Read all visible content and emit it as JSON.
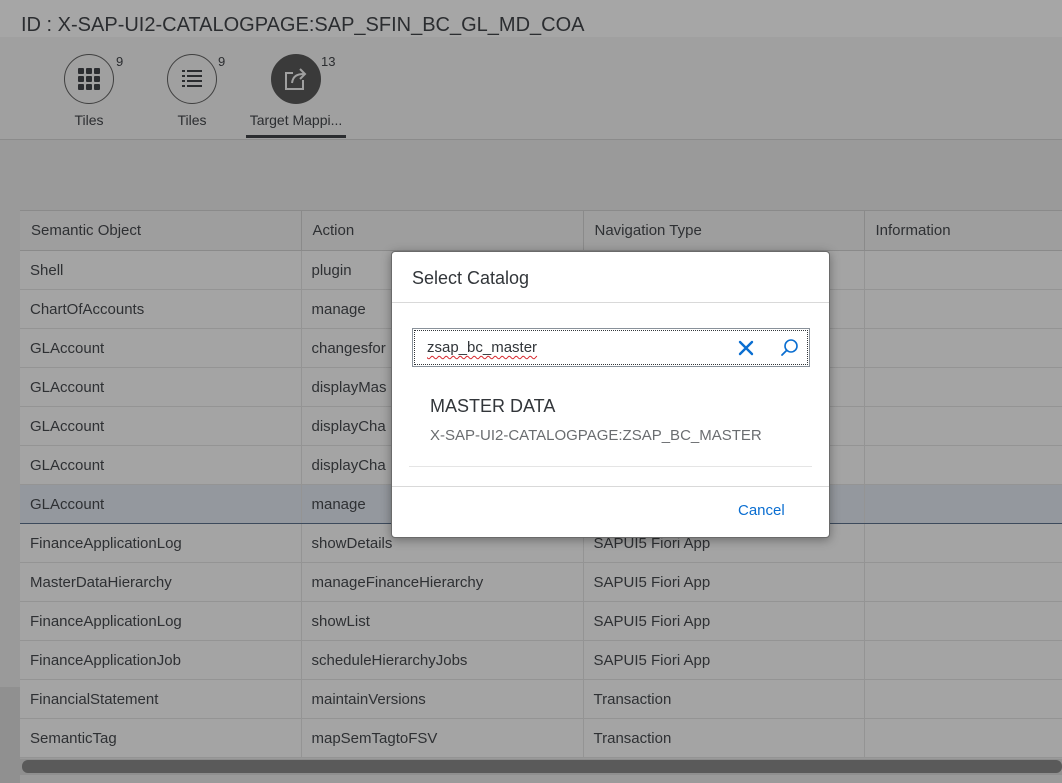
{
  "page": {
    "title": "ID : X-SAP-UI2-CATALOGPAGE:SAP_SFIN_BC_GL_MD_COA"
  },
  "icon_tabs": [
    {
      "label": "Tiles",
      "count": "9",
      "icon": "grid-icon"
    },
    {
      "label": "Tiles",
      "count": "9",
      "icon": "list-icon"
    },
    {
      "label": "Target Mappi...",
      "count": "13",
      "icon": "share-icon",
      "selected": true
    }
  ],
  "table": {
    "columns": [
      "Semantic Object",
      "Action",
      "Navigation Type",
      "Information"
    ],
    "rows": [
      [
        "Shell",
        "plugin",
        "",
        ""
      ],
      [
        "ChartOfAccounts",
        "manage",
        "",
        ""
      ],
      [
        "GLAccount",
        "changesfor",
        "",
        ""
      ],
      [
        "GLAccount",
        "displayMas",
        "",
        ""
      ],
      [
        "GLAccount",
        "displayCha",
        "",
        ""
      ],
      [
        "GLAccount",
        "displayCha",
        "",
        ""
      ],
      [
        "GLAccount",
        "manage",
        "",
        ""
      ],
      [
        "FinanceApplicationLog",
        "showDetails",
        "SAPUI5 Fiori App",
        ""
      ],
      [
        "MasterDataHierarchy",
        "manageFinanceHierarchy",
        "SAPUI5 Fiori App",
        ""
      ],
      [
        "FinanceApplicationLog",
        "showList",
        "SAPUI5 Fiori App",
        ""
      ],
      [
        "FinanceApplicationJob",
        "scheduleHierarchyJobs",
        "SAPUI5 Fiori App",
        ""
      ],
      [
        "FinancialStatement",
        "maintainVersions",
        "Transaction",
        ""
      ],
      [
        "SemanticTag",
        "mapSemTagtoFSV",
        "Transaction",
        ""
      ]
    ]
  },
  "dialog": {
    "title": "Select Catalog",
    "search_value": "zsap_bc_master",
    "results": [
      {
        "title": "MASTER DATA",
        "description": "X-SAP-UI2-CATALOGPAGE:ZSAP_BC_MASTER"
      }
    ],
    "cancel_label": "Cancel"
  },
  "colors": {
    "accent": "#0a6ed1",
    "overlay_bg": "#9a9a9a",
    "selected_tab": "#3a3a3a"
  }
}
